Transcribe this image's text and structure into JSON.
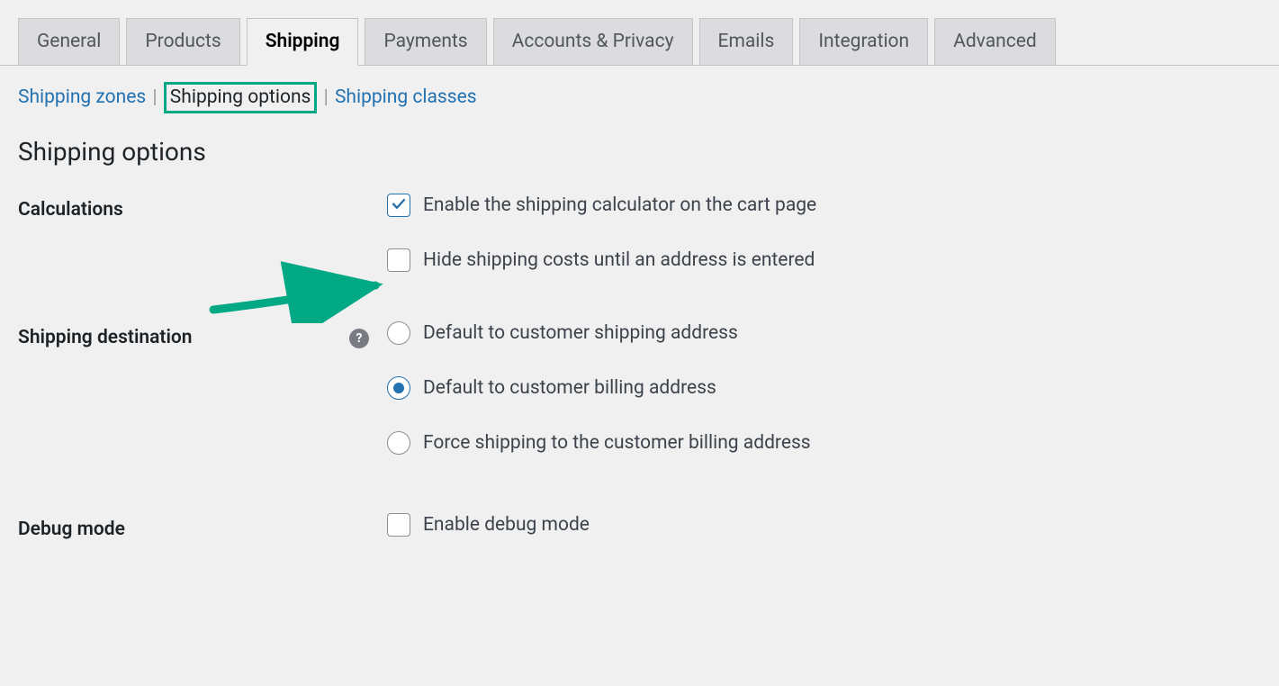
{
  "tabs": [
    {
      "label": "General"
    },
    {
      "label": "Products"
    },
    {
      "label": "Shipping"
    },
    {
      "label": "Payments"
    },
    {
      "label": "Accounts & Privacy"
    },
    {
      "label": "Emails"
    },
    {
      "label": "Integration"
    },
    {
      "label": "Advanced"
    }
  ],
  "subnav": {
    "zones": "Shipping zones",
    "options": "Shipping options",
    "classes": "Shipping classes"
  },
  "page_title": "Shipping options",
  "sections": {
    "calculations": {
      "label": "Calculations",
      "enable_calculator": "Enable the shipping calculator on the cart page",
      "hide_costs": "Hide shipping costs until an address is entered"
    },
    "destination": {
      "label": "Shipping destination",
      "opt_shipping": "Default to customer shipping address",
      "opt_billing": "Default to customer billing address",
      "opt_force": "Force shipping to the customer billing address"
    },
    "debug": {
      "label": "Debug mode",
      "enable": "Enable debug mode"
    }
  }
}
